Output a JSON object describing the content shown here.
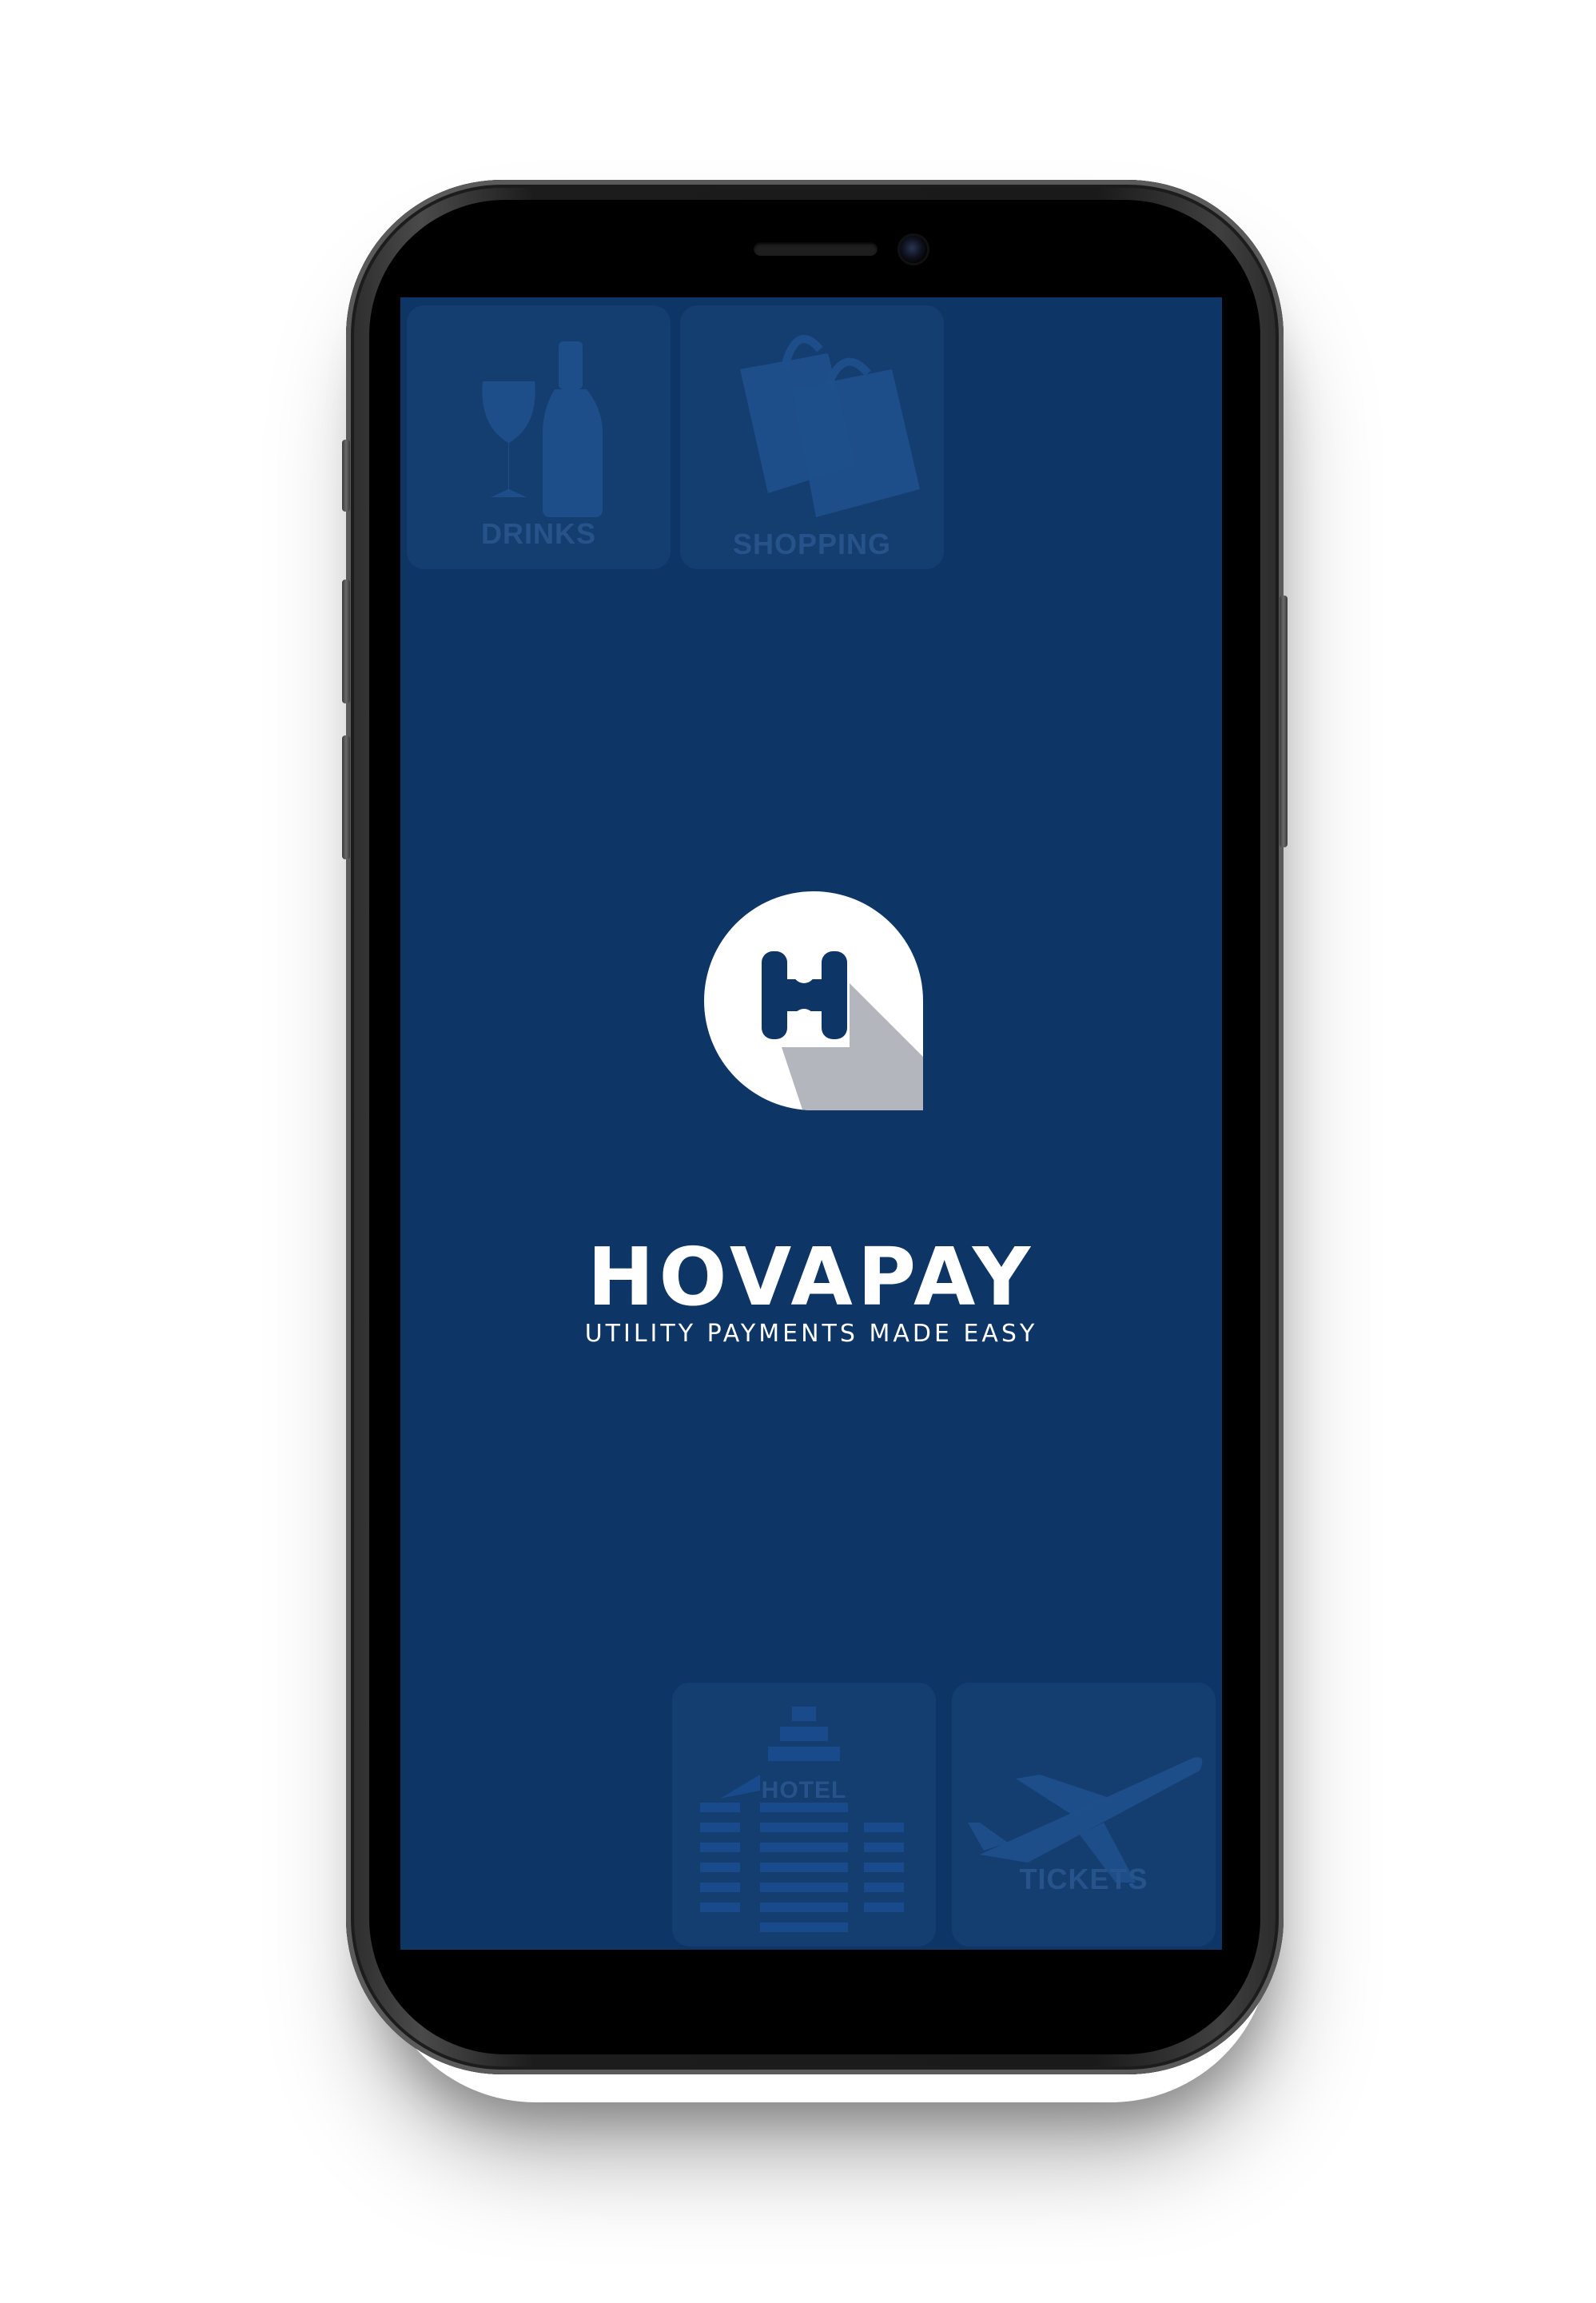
{
  "app": {
    "brand_name": "HOVAPAY",
    "tagline": "UTILITY PAYMENTS MADE EASY"
  },
  "background_tiles": [
    {
      "label": "DRINKS",
      "icon": "wine-bottle-icon"
    },
    {
      "label": "SHOPPING",
      "icon": "shopping-bags-icon"
    },
    {
      "label": "HOTEL",
      "icon": "hotel-building-icon"
    },
    {
      "label": "TICKETS",
      "icon": "airplane-icon"
    }
  ],
  "logo": {
    "icon": "h-chat-bubble-logo-icon",
    "letter": "H"
  },
  "colors": {
    "screen_background": "#0d3566",
    "logo_white": "#ffffff",
    "logo_shadow": "#b3b6bd",
    "text": "#ffffff"
  }
}
